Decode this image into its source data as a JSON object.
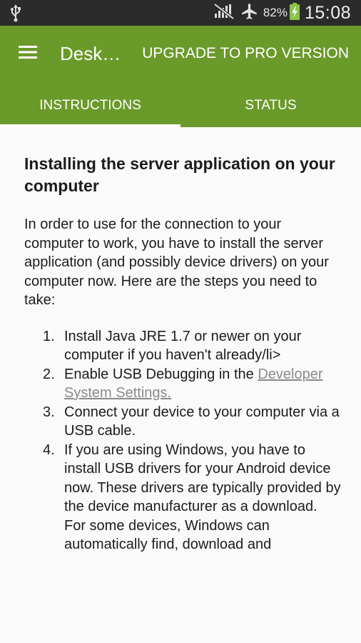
{
  "status_bar": {
    "battery_percent": "82%",
    "time": "15:08",
    "icons": [
      "usb-icon",
      "no-signal-icon",
      "airplane-mode-icon",
      "battery-charging-icon"
    ]
  },
  "app_bar": {
    "title": "Desk…",
    "upgrade_label": "UPGRADE TO PRO VERSION",
    "color": "#6a9a2a"
  },
  "tabs": [
    {
      "label": "INSTRUCTIONS",
      "active": true
    },
    {
      "label": "STATUS",
      "active": false
    }
  ],
  "content": {
    "heading": "Installing the server application on your computer",
    "intro": "In order to use for the connection to your computer to work, you have to install the server application (and possibly device drivers) on your computer now. Here are the steps you need to take:",
    "steps": [
      {
        "number": "1.",
        "text": "Install Java JRE 1.7 or newer on your computer if you haven't already/li>"
      },
      {
        "number": "2.",
        "text": "Enable USB Debugging in the",
        "link": "Developer System Settings."
      },
      {
        "number": "3.",
        "text": "Connect your device to your computer via a USB cable."
      },
      {
        "number": "4.",
        "text": "If you are using Windows, you have to install USB drivers for your Android device now. These drivers are typically provided by the device manufacturer as a download. For some devices, Windows can automatically find, download and"
      }
    ]
  }
}
